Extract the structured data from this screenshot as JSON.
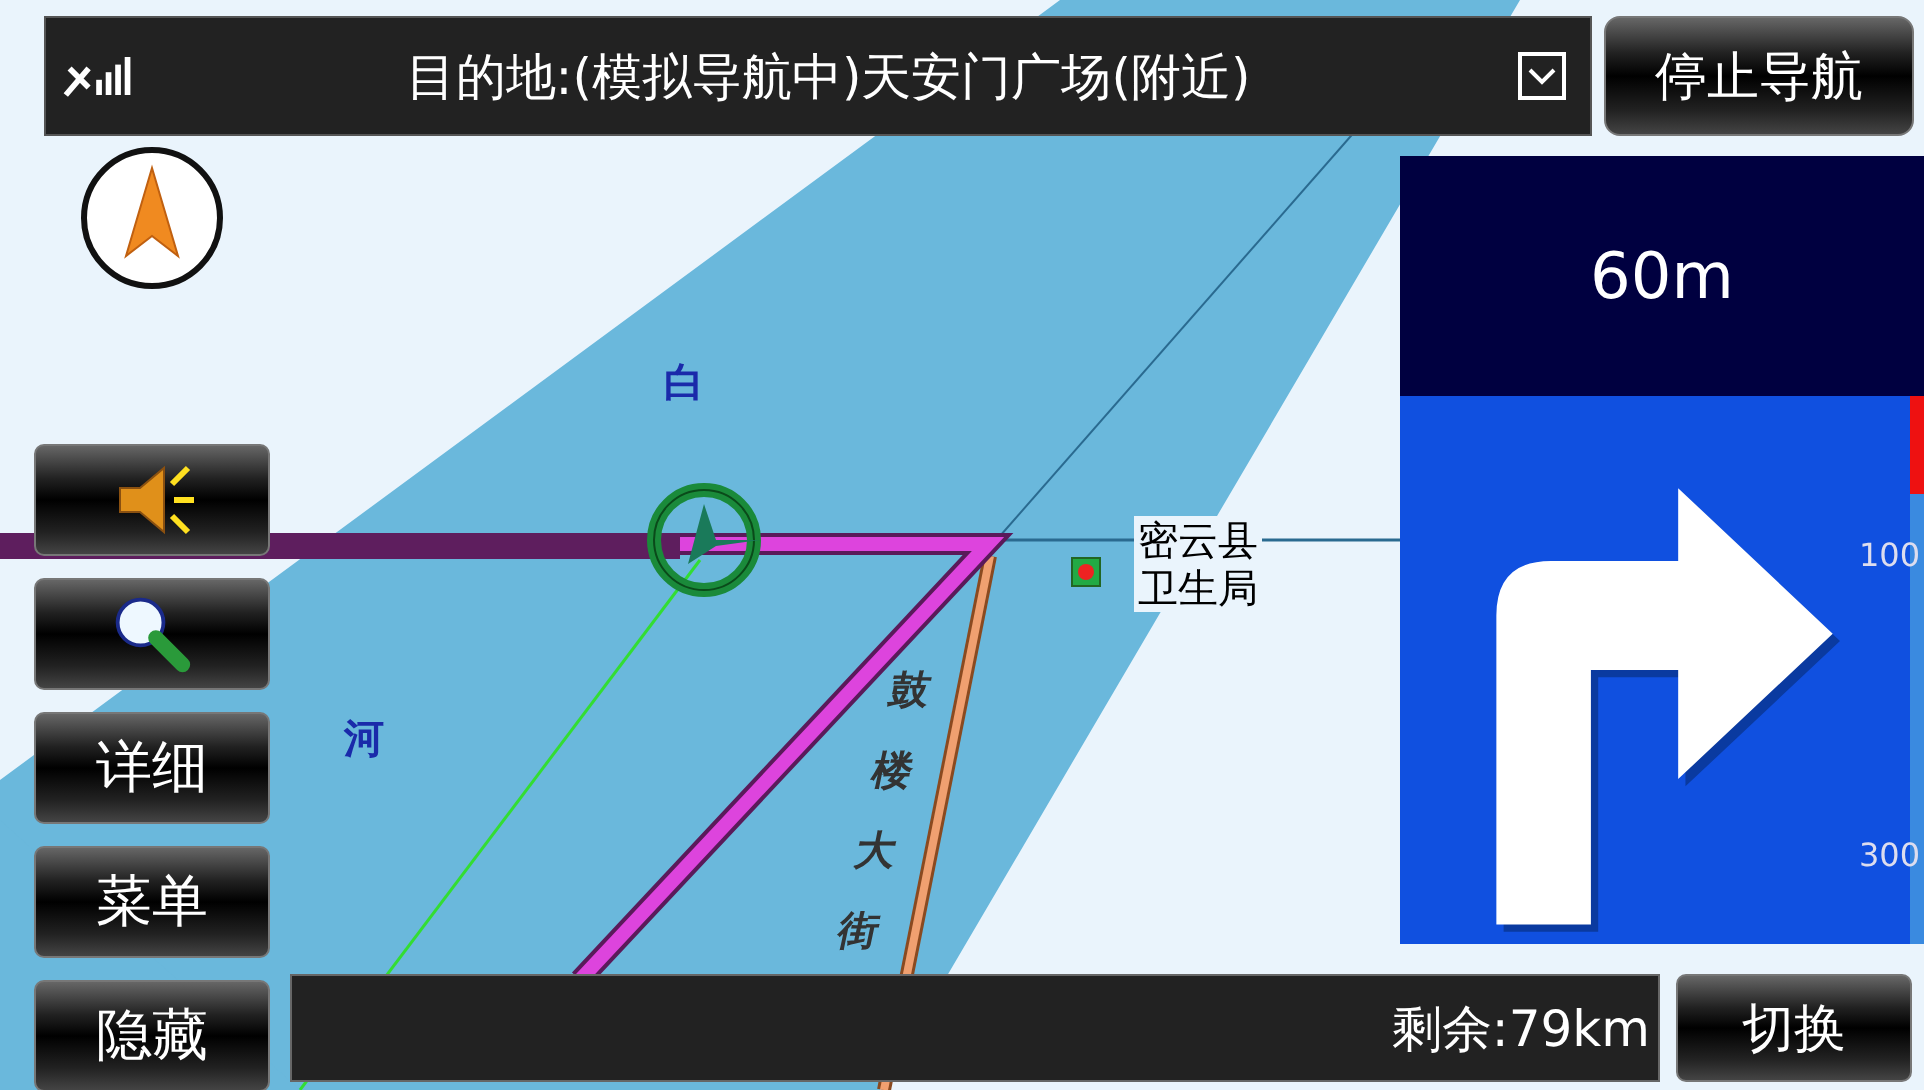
{
  "top_bar": {
    "destination": "目的地:(模拟导航中)天安门广场(附近)",
    "stop_button": "停止导航"
  },
  "side_buttons": [
    {
      "kind": "speaker"
    },
    {
      "kind": "magnifier"
    },
    {
      "kind": "text",
      "label": "详细"
    },
    {
      "kind": "text",
      "label": "菜单"
    },
    {
      "kind": "text",
      "label": "隐藏"
    }
  ],
  "map_labels": [
    {
      "kind": "water",
      "text": "白"
    },
    {
      "kind": "water",
      "text": "河"
    },
    {
      "kind": "poi",
      "lines": [
        "密云县",
        "卫生局"
      ]
    },
    {
      "kind": "road",
      "text": "鼓楼大街"
    }
  ],
  "turn_panel": {
    "distance": "60m",
    "meter": {
      "level": 0.18,
      "ticks": [
        "100",
        "300"
      ]
    }
  },
  "bottom_bar": {
    "remaining": "剩余:79km",
    "switch_button": "切换"
  }
}
